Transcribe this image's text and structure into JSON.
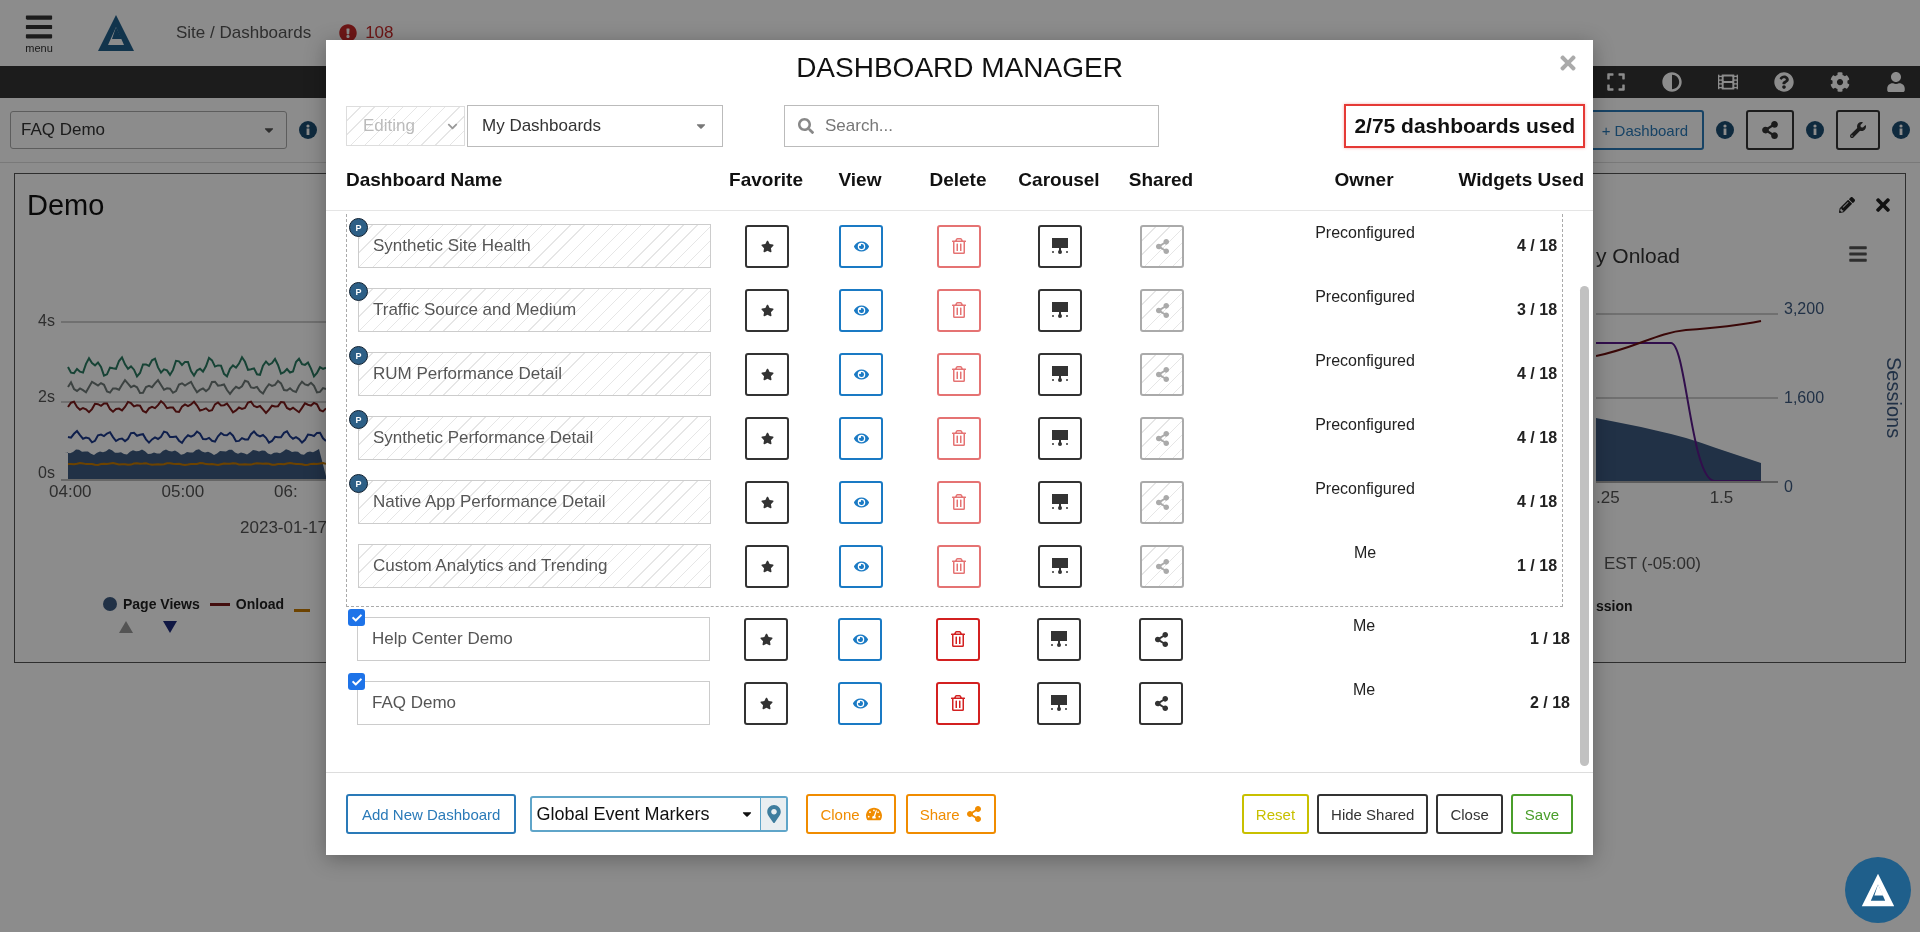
{
  "app_bar": {
    "menu_label": "menu",
    "breadcrumb": "Site / Dashboards",
    "alert_count": "108"
  },
  "toolbar": {
    "dashboard_select": {
      "value": "FAQ Demo"
    },
    "add_dashboard_button": "+ Dashboard"
  },
  "widget_panel": {
    "title": "Demo",
    "left_chart": {
      "y_ticks": [
        "4s",
        "2s",
        "0s"
      ],
      "x_ticks": [
        "04:00",
        "05:00",
        "06:"
      ],
      "date": "2023-01-17",
      "legend": [
        {
          "label": "Page Views",
          "kind": "dot"
        },
        {
          "label": "Onload",
          "kind": "line"
        }
      ]
    },
    "right_chart": {
      "title": "y Onload",
      "y_ticks": [
        "3,200",
        "1,600",
        "0"
      ],
      "y_label": "Sessions",
      "x_ticks": [
        ".25",
        "1.5"
      ],
      "timezone": "EST (-05:00)",
      "legend_fragment": "ssion"
    }
  },
  "modal": {
    "title": "DASHBOARD MANAGER",
    "mode_select": {
      "value": "Editing",
      "disabled": true
    },
    "scope_select": {
      "value": "My Dashboards"
    },
    "search": {
      "placeholder": "Search..."
    },
    "usage": "2/75 dashboards used",
    "columns": [
      "Dashboard Name",
      "Favorite",
      "View",
      "Delete",
      "Carousel",
      "Shared",
      "Owner",
      "Widgets Used"
    ],
    "locked_rows": [
      {
        "kind": "preconfigured",
        "badge": "P",
        "name": "Synthetic Site Health",
        "owner": "Preconfigured",
        "widgets": "4 / 18"
      },
      {
        "kind": "preconfigured",
        "badge": "P",
        "name": "Traffic Source and Medium",
        "owner": "Preconfigured",
        "widgets": "3 / 18"
      },
      {
        "kind": "preconfigured",
        "badge": "P",
        "name": "RUM Performance Detail",
        "owner": "Preconfigured",
        "widgets": "4 / 18"
      },
      {
        "kind": "preconfigured",
        "badge": "P",
        "name": "Synthetic Performance Detail",
        "owner": "Preconfigured",
        "widgets": "4 / 18"
      },
      {
        "kind": "preconfigured",
        "badge": "P",
        "name": "Native App Performance Detail",
        "owner": "Preconfigured",
        "widgets": "4 / 18"
      },
      {
        "kind": "shared",
        "name": "Custom Analytics and Trending",
        "owner": "Me",
        "widgets": "1 / 18"
      }
    ],
    "own_rows": [
      {
        "name": "Help Center Demo",
        "checked": true,
        "owner": "Me",
        "widgets": "1 / 18"
      },
      {
        "name": "FAQ Demo",
        "checked": true,
        "owner": "Me",
        "widgets": "2 / 18"
      }
    ],
    "footer": {
      "add_button": "Add New Dashboard",
      "marker_select": {
        "value": "Global Event Markers"
      },
      "clone_button": "Clone",
      "share_button": "Share",
      "actions": [
        {
          "label": "Reset",
          "kind": "reset"
        },
        {
          "label": "Hide Shared",
          "kind": "plain"
        },
        {
          "label": "Close",
          "kind": "plain"
        },
        {
          "label": "Save",
          "kind": "save"
        }
      ]
    }
  }
}
